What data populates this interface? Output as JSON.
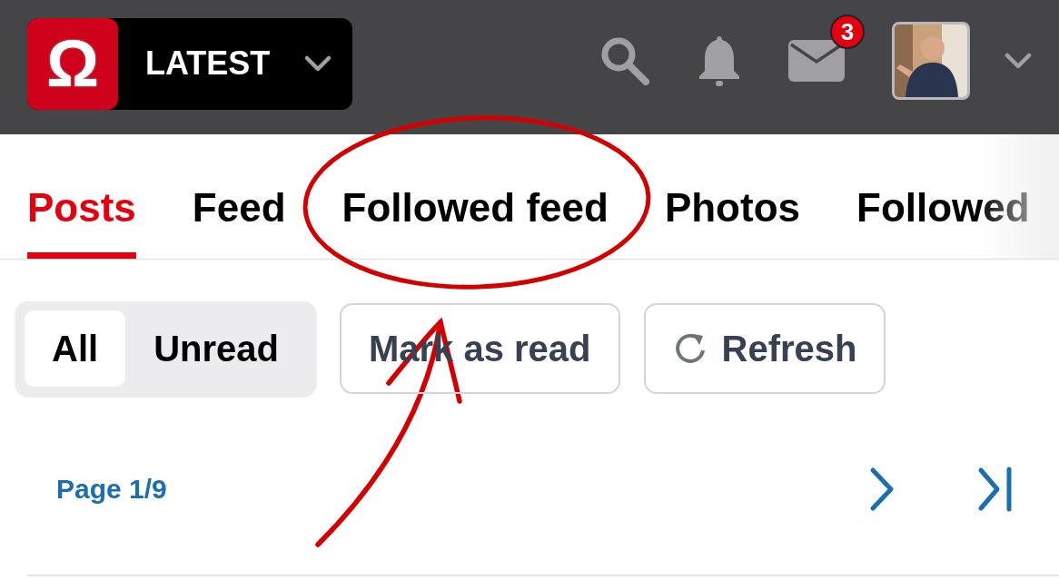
{
  "header": {
    "logo": "Ω",
    "section": "LATEST",
    "mail_badge": "3"
  },
  "tabs": [
    {
      "label": "Posts",
      "selected": true
    },
    {
      "label": "Feed",
      "selected": false
    },
    {
      "label": "Followed feed",
      "selected": false
    },
    {
      "label": "Photos",
      "selected": false
    },
    {
      "label": "Followed",
      "selected": false
    }
  ],
  "filter": [
    {
      "label": "All",
      "selected": true
    },
    {
      "label": "Unread",
      "selected": false
    }
  ],
  "actions": [
    {
      "label": "Mark as read",
      "kind": "plain"
    },
    {
      "label": "Refresh",
      "kind": "refresh"
    }
  ],
  "pager": {
    "label": "Page 1/9"
  }
}
